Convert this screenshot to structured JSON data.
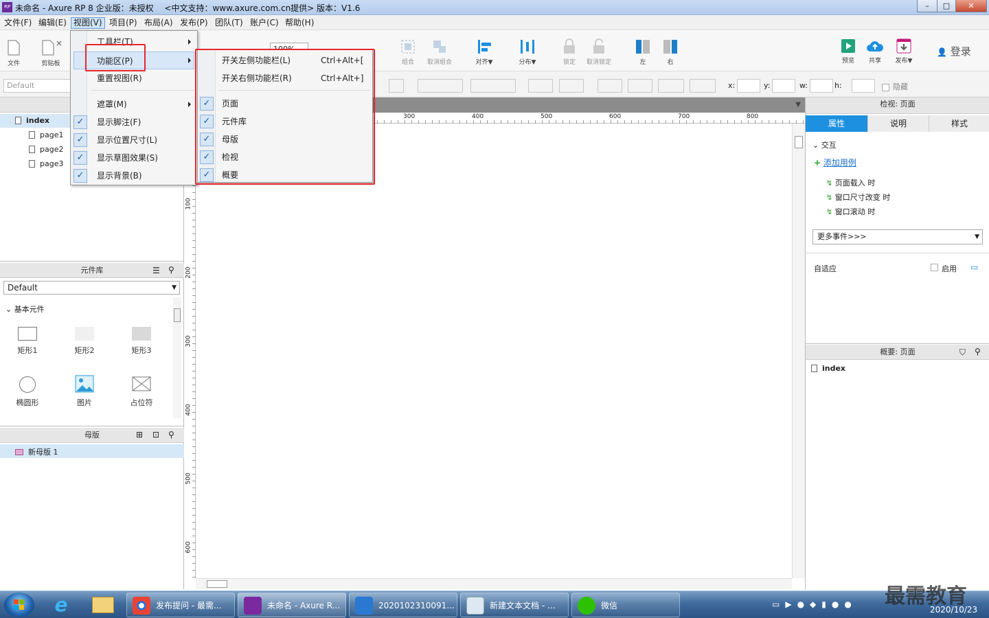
{
  "window": {
    "title": "未命名 - Axure RP 8 企业版：未授权 　<中文支持：www.axure.com.cn提供> 版本：V1.6",
    "app_icon_text": "RP",
    "controls": {
      "minimize": "–",
      "maximize": "□",
      "close": "✕"
    }
  },
  "menubar": [
    {
      "label": "文件(F)"
    },
    {
      "label": "编辑(E)"
    },
    {
      "label": "视图(V)"
    },
    {
      "label": "项目(P)"
    },
    {
      "label": "布局(A)"
    },
    {
      "label": "发布(P)"
    },
    {
      "label": "团队(T)"
    },
    {
      "label": "账户(C)"
    },
    {
      "label": "帮助(H)"
    }
  ],
  "toolbar": {
    "file_label": "文件",
    "clipboard_label": "剪贴板",
    "zoom_value": "100%",
    "group_label": "组合",
    "ungroup_label": "取消组合",
    "align_label": "对齐▼",
    "distribute_label": "分布▼",
    "lock_label": "锁定",
    "unlock_label": "取消锁定",
    "left_label": "左",
    "right_label": "右",
    "preview_label": "预览",
    "share_label": "共享",
    "publish_label": "发布▼",
    "login_label": "登录"
  },
  "format": {
    "style_placeholder": "Default",
    "x_label": "x:",
    "y_label": "y:",
    "w_label": "w:",
    "h_label": "h:",
    "hidden_label": "隐藏"
  },
  "pages_panel": {
    "items": [
      {
        "label": "index"
      },
      {
        "label": "page1"
      },
      {
        "label": "page2"
      },
      {
        "label": "page3"
      }
    ]
  },
  "library_panel": {
    "title": "元件库",
    "selected_library": "Default",
    "section": "基本元件",
    "widgets": [
      {
        "label": "矩形1"
      },
      {
        "label": "矩形2"
      },
      {
        "label": "矩形3"
      },
      {
        "label": "椭圆形"
      },
      {
        "label": "图片"
      },
      {
        "label": "占位符"
      }
    ]
  },
  "masters_panel": {
    "title": "母版",
    "items": [
      {
        "label": "新母版 1"
      }
    ]
  },
  "ruler": {
    "h_ticks": [
      "300",
      "400",
      "500",
      "600",
      "700",
      "800"
    ],
    "v_ticks": [
      "100",
      "200",
      "300",
      "400",
      "500",
      "600"
    ]
  },
  "inspector": {
    "title": "检视: 页面",
    "tabs": [
      "属性",
      "说明",
      "样式"
    ],
    "section_interaction": "交互",
    "add_case": "添加用例",
    "events": [
      "页面载入 时",
      "窗口尺寸改变 时",
      "窗口滚动 时"
    ],
    "more_events": "更多事件>>>",
    "adaptive_label": "自适应",
    "enable_label": "启用"
  },
  "outline": {
    "title": "概要: 页面",
    "items": [
      {
        "label": "index"
      }
    ]
  },
  "view_menu": {
    "items": [
      {
        "label": "工具栏(T)",
        "submenu": true
      },
      {
        "label": "功能区(P)",
        "submenu": true
      },
      {
        "label": "重置视图(R)"
      },
      {
        "label": "遮罩(M)",
        "submenu": true
      },
      {
        "label": "显示脚注(F)",
        "checked": true
      },
      {
        "label": "显示位置尺寸(L)",
        "checked": true
      },
      {
        "label": "显示草图效果(S)",
        "checked": true
      },
      {
        "label": "显示背景(B)",
        "checked": true
      }
    ]
  },
  "function_submenu": {
    "items": [
      {
        "label": "开关左侧功能栏(L)",
        "shortcut": "Ctrl+Alt+["
      },
      {
        "label": "开关右侧功能栏(R)",
        "shortcut": "Ctrl+Alt+]"
      },
      {
        "label": "页面",
        "checked": true
      },
      {
        "label": "元件库",
        "checked": true
      },
      {
        "label": "母版",
        "checked": true
      },
      {
        "label": "检视",
        "checked": true
      },
      {
        "label": "概要",
        "checked": true
      }
    ]
  },
  "taskbar": {
    "tasks": [
      {
        "label": "发布提问 - 最需..."
      },
      {
        "label": "未命名 - Axure R..."
      },
      {
        "label": "2020102310091..."
      },
      {
        "label": "新建文本文档 - ..."
      },
      {
        "label": "微信"
      }
    ],
    "clock_date": "2020/10/23",
    "watermark": "最需教育"
  },
  "colors": {
    "accent_blue": "#1e90e0",
    "highlight_red": "#e8262b",
    "check_blue": "#1f5aa8"
  }
}
